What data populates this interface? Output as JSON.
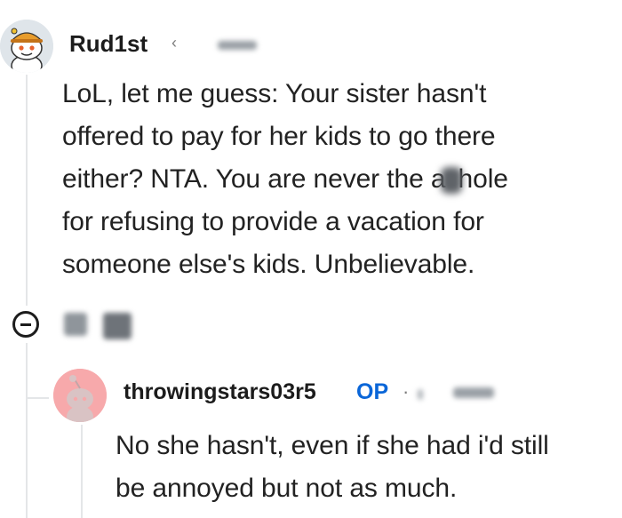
{
  "thread": {
    "parent_comment": {
      "username": "Rud1st",
      "avatar": "snoo-avatar-with-hat-icon",
      "body_lines": [
        "LoL, let me guess: Your sister hasn't",
        "offered to pay for her kids to go there",
        "either? NTA. You are never the a",
        "for refusing to provide a vacation for",
        "someone else's kids. Unbelievable."
      ],
      "body_line3_suffix": "hole"
    },
    "collapse_control": {
      "icon": "collapse-minus-icon"
    },
    "reply": {
      "username": "throwingstars03r5",
      "badge": "OP",
      "separator": "·",
      "avatar": "snoo-avatar-pink-icon",
      "body_lines": [
        "No she hasn't, even if she had i'd still",
        "be annoyed but not as much."
      ]
    }
  },
  "colors": {
    "op_badge": "#0a66d8",
    "thread_line": "#e4e6e8",
    "reply_avatar_bg": "#f7a9ab"
  }
}
